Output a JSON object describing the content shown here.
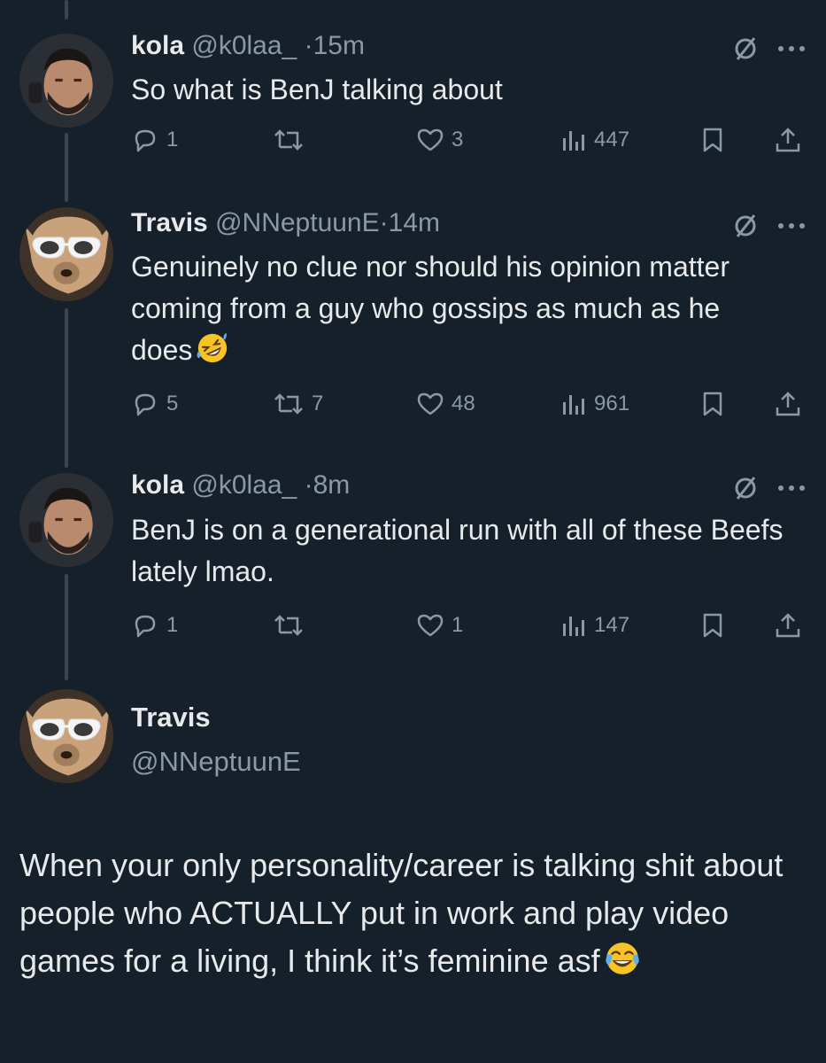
{
  "tweets": [
    {
      "name": "kola",
      "handle": "@k0laa_",
      "time": "15m",
      "text": "So what is BenJ talking about",
      "emoji": "",
      "replies": "1",
      "retweets": "",
      "likes": "3",
      "views": "447"
    },
    {
      "name": "Travis",
      "handle": "@NNeptuunE",
      "time": "14m",
      "text": "Genuinely no clue nor should his opinion matter coming from a guy who gossips as much as he does",
      "emoji": "rolling-on-floor-laughing",
      "replies": "5",
      "retweets": "7",
      "likes": "48",
      "views": "961"
    },
    {
      "name": "kola",
      "handle": "@k0laa_",
      "time": "8m",
      "text": "BenJ is on a generational run with all of these Beefs lately lmao.",
      "emoji": "",
      "replies": "1",
      "retweets": "",
      "likes": "1",
      "views": "147"
    }
  ],
  "main_post": {
    "name": "Travis",
    "handle": "@NNeptuunE",
    "text": "When your only personality/career is talking shit about people who ACTUALLY put in work and play video games for a living, I think it’s feminine asf",
    "emoji": "face-with-tears-of-joy"
  },
  "colors": {
    "background": "#15202b",
    "text": "#e7e9ea",
    "muted": "#8b98a5",
    "thread_line": "#3a4550"
  },
  "icons": [
    "mute-icon",
    "more-icon",
    "reply-icon",
    "retweet-icon",
    "like-icon",
    "views-icon",
    "bookmark-icon",
    "share-icon"
  ]
}
